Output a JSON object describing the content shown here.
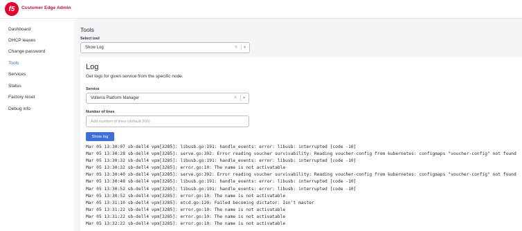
{
  "header": {
    "logo_text": "f5",
    "title": "Customer Edge Admin"
  },
  "sidebar": {
    "items": [
      {
        "label": "Dashboard"
      },
      {
        "label": "DHCP leases"
      },
      {
        "label": "Change password"
      },
      {
        "label": "Tools",
        "active": true
      },
      {
        "label": "Services"
      },
      {
        "label": "Status"
      },
      {
        "label": "Factory reset"
      },
      {
        "label": "Debug info"
      }
    ]
  },
  "main": {
    "title": "Tools",
    "select_tool_label": "Select tool",
    "selected_tool": "Show Log"
  },
  "log_card": {
    "title": "Log",
    "description": "Get logs for given service from the specific node.",
    "service_label": "Service",
    "service_value": "Volterra Platform Manager",
    "lines_label": "Number of lines",
    "lines_placeholder": "Add number of lines (default 200)",
    "show_button": "Show log",
    "log_lines": [
      "Mar 05 13:30:07 sb-dell4 vpm[3285]: libusb.go:191: handle_events: error: libusb: interrupted [code -10]",
      "Mar 05 13:30:28 sb-dell4 vpm[3285]: serve.go:392: Error reading voucher survivability: Reading voucher-config from kubernetes: configmaps \"voucher-config\" not found",
      "Mar 05 13:30:32 sb-dell4 vpm[3285]: libusb.go:191: handle_events: error: libusb: interrupted [code -10]",
      "Mar 05 13:30:32 sb-dell4 vpm[3285]: error.go:10: The name is not activatable",
      "Mar 05 13:30:40 sb-dell4 vpm[3285]: serve.go:392: Error reading voucher survivability: Reading voucher-config from kubernetes: configmaps \"voucher-config\" not found",
      "Mar 05 13:30:48 sb-dell4 vpm[3285]: libusb.go:191: handle_events: error: libusb: interrupted [code -10]",
      "Mar 05 13:30:52 sb-dell4 vpm[3285]: libusb.go:191: handle_events: error: libusb: interrupted [code -10]",
      "Mar 05 13:30:52 sb-dell4 vpm[3285]: error.go:10: The name is not activatable",
      "Mar 05 13:31:10 sb-dell4 vpm[3285]: etcd.go:120: Failed becoming dictator: Isn't master",
      "Mar 05 13:31:22 sb-dell4 vpm[3285]: error.go:10: The name is not activatable",
      "Mar 05 13:31:22 sb-dell4 vpm[3285]: error.go:10: The name is not activatable",
      "Mar 05 13:32:22 sb-dell4 vpm[3285]: error.go:10: The name is not activatable"
    ]
  },
  "colors": {
    "brand": "#e4002b",
    "accent": "#3f6fd8",
    "active_nav": "#3a6ad6"
  },
  "icons": {
    "clear": "close-icon",
    "dropdown": "chevron-down-icon"
  }
}
